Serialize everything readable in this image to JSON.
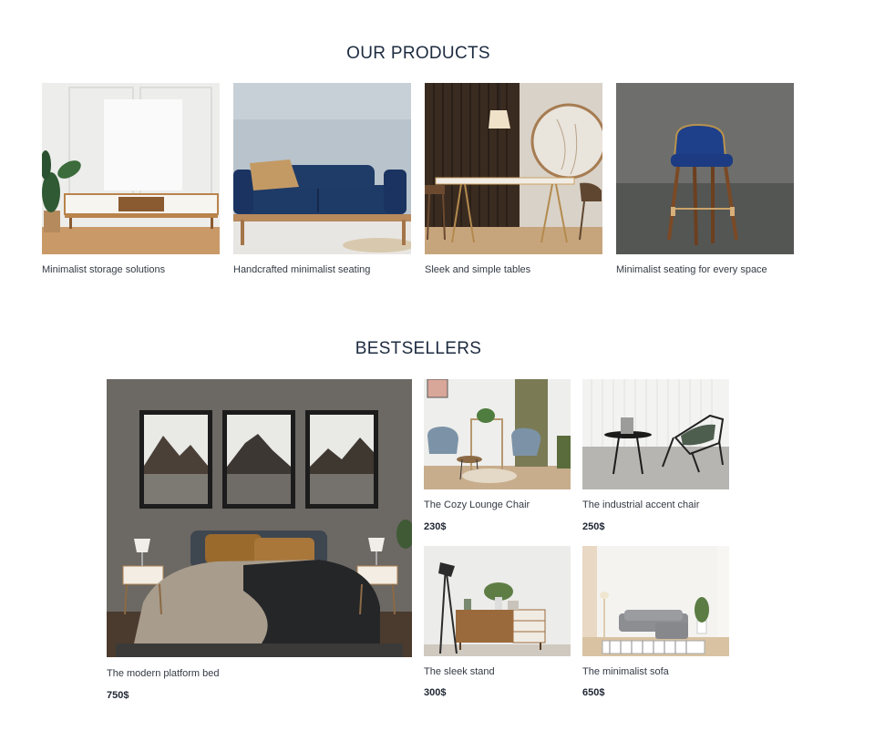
{
  "products": {
    "title": "OUR PRODUCTS",
    "items": [
      {
        "label": "Minimalist storage solutions"
      },
      {
        "label": "Handcrafted minimalist seating"
      },
      {
        "label": "Sleek and simple tables"
      },
      {
        "label": "Minimalist seating for every space"
      }
    ]
  },
  "bestsellers": {
    "title": "BESTSELLERS",
    "featured": {
      "name": "The modern platform bed",
      "price": "750$"
    },
    "items": [
      {
        "name": "The Cozy Lounge Chair",
        "price": "230$"
      },
      {
        "name": "The industrial accent chair",
        "price": "250$"
      },
      {
        "name": "The sleek stand",
        "price": "300$"
      },
      {
        "name": "The minimalist sofa",
        "price": "650$"
      }
    ]
  }
}
